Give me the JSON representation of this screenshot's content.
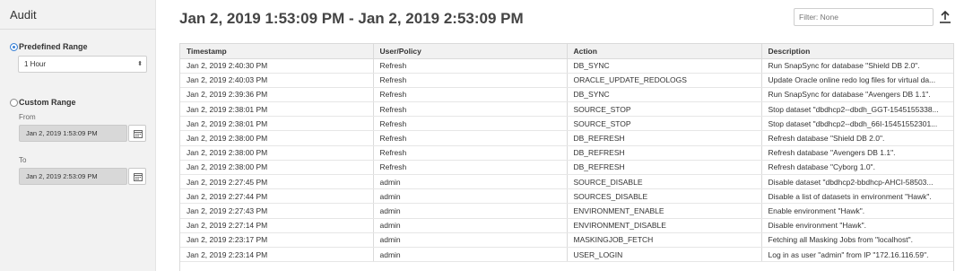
{
  "sidebar": {
    "title": "Audit",
    "predefined_label": "Predefined Range",
    "predefined_value": "1 Hour",
    "custom_label": "Custom Range",
    "from_label": "From",
    "from_value": "Jan 2, 2019 1:53:09 PM",
    "to_label": "To",
    "to_value": "Jan 2, 2019 2:53:09 PM",
    "selected_range": "predefined"
  },
  "header": {
    "title": "Jan 2, 2019 1:53:09 PM - Jan 2, 2019 2:53:09 PM",
    "filter_placeholder": "Filter: None"
  },
  "table": {
    "columns": [
      "Timestamp",
      "User/Policy",
      "Action",
      "Description"
    ],
    "rows": [
      [
        "Jan 2, 2019 2:40:30 PM",
        "Refresh",
        "DB_SYNC",
        "Run SnapSync for database \"Shield DB 2.0\"."
      ],
      [
        "Jan 2, 2019 2:40:03 PM",
        "Refresh",
        "ORACLE_UPDATE_REDOLOGS",
        "Update Oracle online redo log files for virtual da..."
      ],
      [
        "Jan 2, 2019 2:39:36 PM",
        "Refresh",
        "DB_SYNC",
        "Run SnapSync for database \"Avengers DB 1.1\"."
      ],
      [
        "Jan 2, 2019 2:38:01 PM",
        "Refresh",
        "SOURCE_STOP",
        "Stop dataset \"dbdhcp2--dbdh_GGT-1545155338..."
      ],
      [
        "Jan 2, 2019 2:38:01 PM",
        "Refresh",
        "SOURCE_STOP",
        "Stop dataset \"dbdhcp2--dbdh_66I-15451552301..."
      ],
      [
        "Jan 2, 2019 2:38:00 PM",
        "Refresh",
        "DB_REFRESH",
        "Refresh database \"Shield DB 2.0\"."
      ],
      [
        "Jan 2, 2019 2:38:00 PM",
        "Refresh",
        "DB_REFRESH",
        "Refresh database \"Avengers DB 1.1\"."
      ],
      [
        "Jan 2, 2019 2:38:00 PM",
        "Refresh",
        "DB_REFRESH",
        "Refresh database \"Cyborg 1.0\"."
      ],
      [
        "Jan 2, 2019 2:27:45 PM",
        "admin",
        "SOURCE_DISABLE",
        "Disable dataset \"dbdhcp2-bbdhcp-AHCI-58503..."
      ],
      [
        "Jan 2, 2019 2:27:44 PM",
        "admin",
        "SOURCES_DISABLE",
        "Disable a list of datasets in environment \"Hawk\"."
      ],
      [
        "Jan 2, 2019 2:27:43 PM",
        "admin",
        "ENVIRONMENT_ENABLE",
        "Enable environment \"Hawk\"."
      ],
      [
        "Jan 2, 2019 2:27:14 PM",
        "admin",
        "ENVIRONMENT_DISABLE",
        "Disable environment \"Hawk\"."
      ],
      [
        "Jan 2, 2019 2:23:17 PM",
        "admin",
        "MASKINGJOB_FETCH",
        "Fetching all Masking Jobs from \"localhost\"."
      ],
      [
        "Jan 2, 2019 2:23:14 PM",
        "admin",
        "USER_LOGIN",
        "Log in as user \"admin\" from IP \"172.16.116.59\"."
      ]
    ]
  },
  "colors": {
    "accent": "#3b82d6",
    "sidebar_bg": "#f2f2f2",
    "header_bg": "#f1f1f1"
  }
}
